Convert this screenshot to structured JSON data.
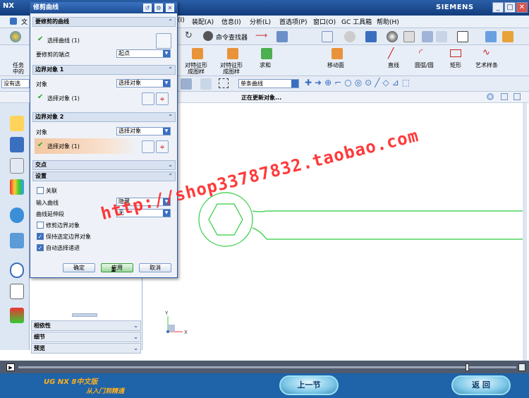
{
  "window": {
    "logo": "NX",
    "brand": "SIEMENS",
    "min": "_",
    "max": "□",
    "close": "✕"
  },
  "menubar": {
    "items": [
      "文",
      "(I)",
      "装配(A)",
      "信息(I)",
      "分析(L)",
      "首选项(P)",
      "窗口(O)",
      "GC 工具箱",
      "帮助(H)"
    ]
  },
  "toolbar": {
    "cmd_finder": "命令查找器",
    "task_label": "任务\n中的",
    "feat1": "对特征形\n成图样",
    "feat2": "对特征形\n成图样",
    "sum": "求和",
    "move": "移动面",
    "line": "直线",
    "arc": "圆弧/圆",
    "rect": "矩形",
    "spline": "艺术样条"
  },
  "selection": {
    "filter_left": "没有选",
    "filter": "单条曲线"
  },
  "status": {
    "updating": "正在更新对象..."
  },
  "navigator": {
    "sections": [
      "相依性",
      "细节",
      "预览"
    ]
  },
  "dialog": {
    "title": "修剪曲线",
    "group1": "要修剪的曲线",
    "select_curve": "选择曲线 (1)",
    "endpoint_label": "要修剪的端点",
    "endpoint_value": "起点",
    "group2": "边界对象 1",
    "object_label": "对象",
    "object_value": "选择对象",
    "select_object1": "选择对象 (1)",
    "group3": "边界对象 2",
    "object2_label": "对象",
    "object2_value": "选择对象",
    "select_object2": "选择对象 (1)",
    "intersection": "交点",
    "settings": "设置",
    "associative": "关联",
    "input_curve_label": "输入曲线",
    "input_curve_value": "隐藏",
    "extend_label": "曲线延伸段",
    "extend_value": "无",
    "trim_boundary": "修剪边界对象",
    "keep_selected": "保持选定边界对象",
    "auto_select": "自动选择递进",
    "ok": "确定",
    "apply": "应用",
    "cancel": "取消"
  },
  "watermark": "http://shop33787832.taobao.com",
  "footer": {
    "course_title": "UG NX 8中文版",
    "course_subtitle": "从入门到精通",
    "prev": "上一节",
    "back": "返  回"
  },
  "colors": {
    "title_blue": "#1d4d94",
    "curve_green": "#2ecc40",
    "watermark_red": "#ff2a2a",
    "footer_blue": "#1f63a8"
  }
}
